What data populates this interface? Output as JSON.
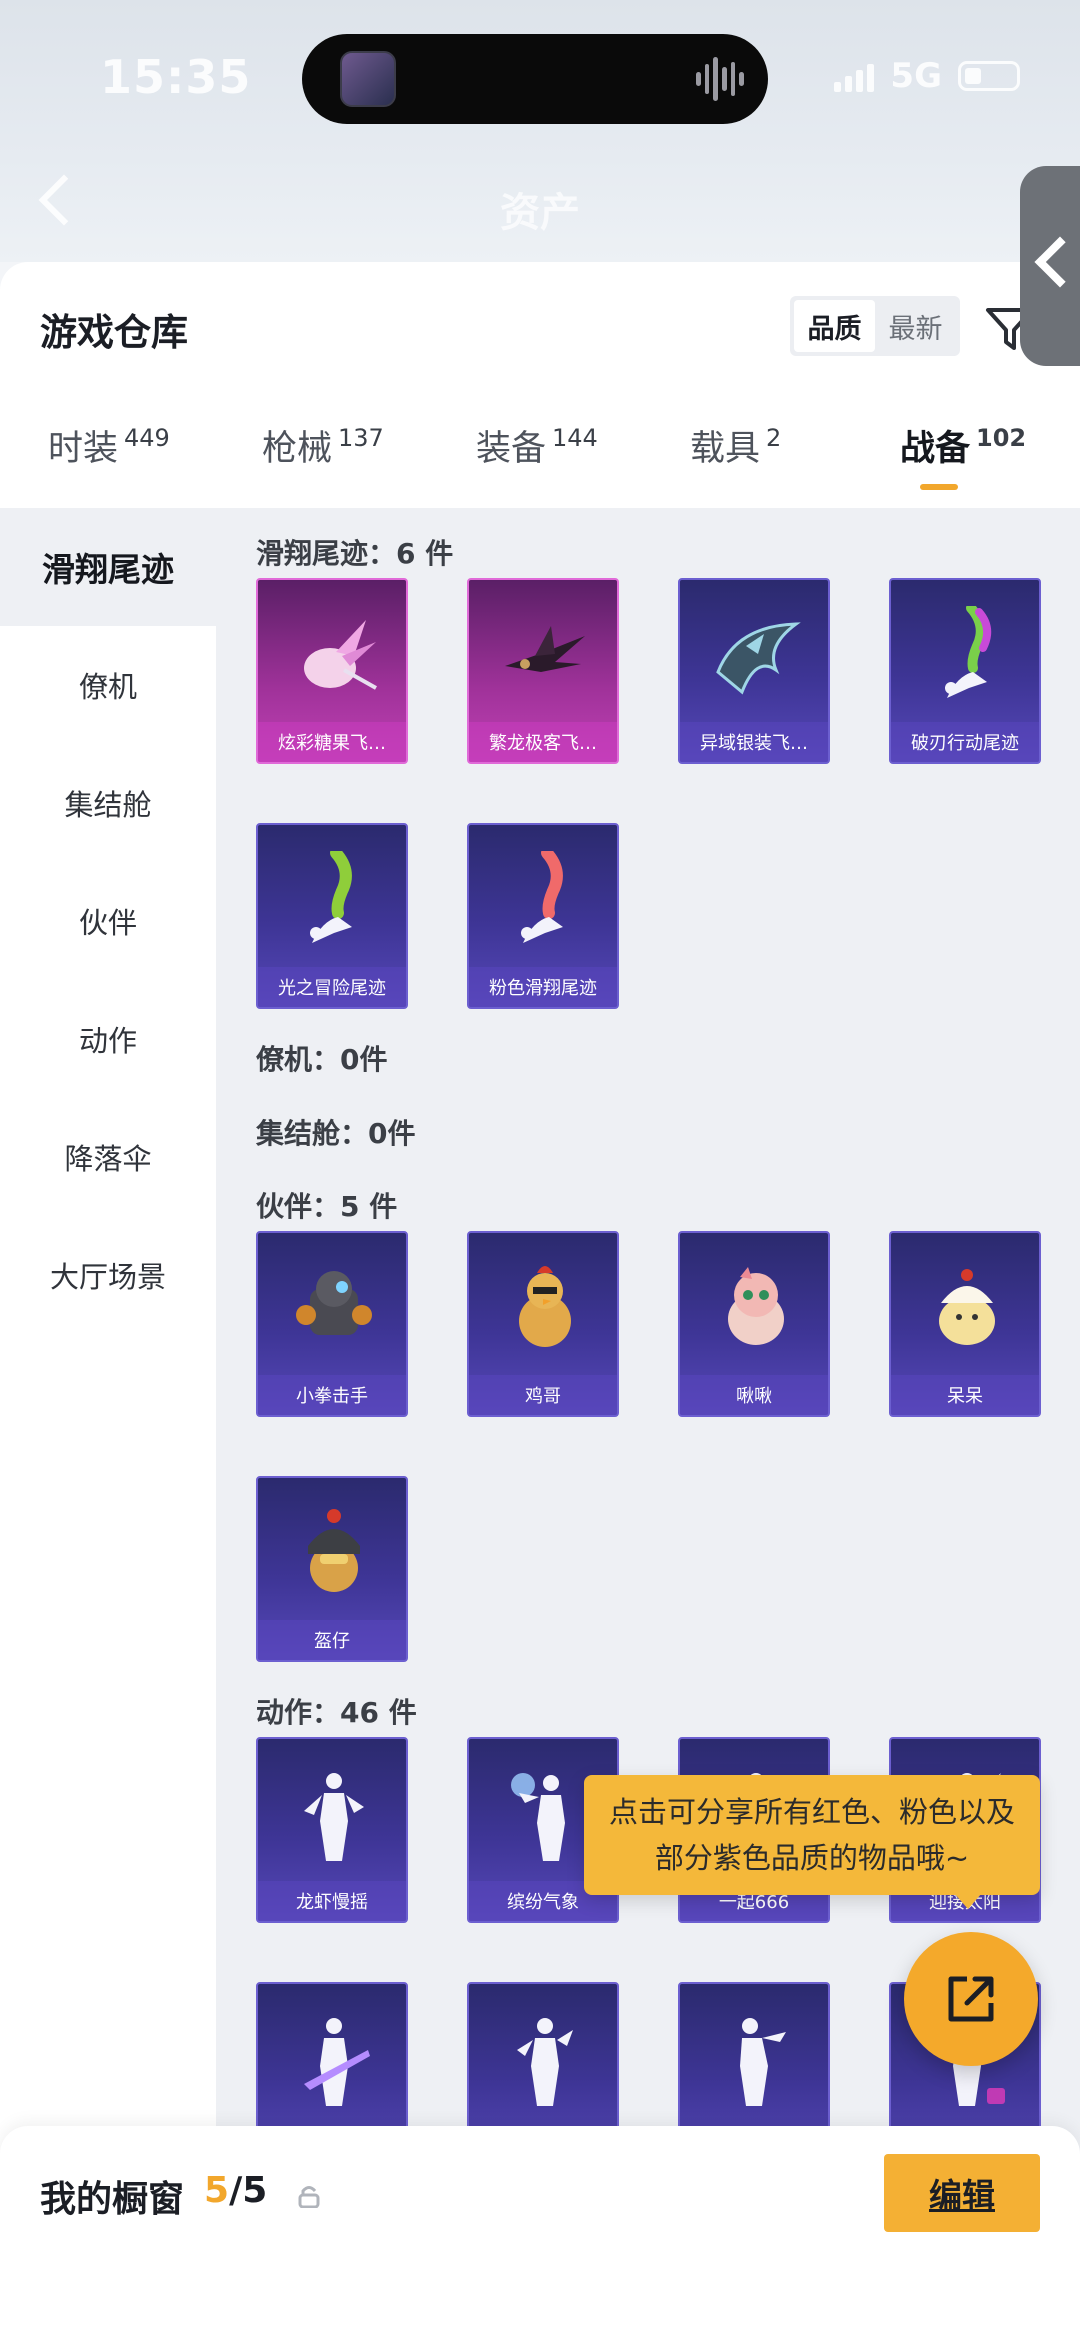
{
  "status": {
    "time": "15:35",
    "network": "5G"
  },
  "header": {
    "title": "资产"
  },
  "warehouse": {
    "title": "游戏仓库",
    "sort": {
      "quality": "品质",
      "newest": "最新",
      "selected": "品质"
    }
  },
  "tabs": [
    {
      "label": "时装",
      "count": "449"
    },
    {
      "label": "枪械",
      "count": "137"
    },
    {
      "label": "装备",
      "count": "144"
    },
    {
      "label": "载具",
      "count": "2"
    },
    {
      "label": "战备",
      "count": "102",
      "active": true
    }
  ],
  "sidebar": {
    "items": [
      {
        "label": "滑翔尾迹",
        "active": true
      },
      {
        "label": "僚机"
      },
      {
        "label": "集结舱"
      },
      {
        "label": "伙伴"
      },
      {
        "label": "动作"
      },
      {
        "label": "降落伞"
      },
      {
        "label": "大厅场景"
      }
    ]
  },
  "sections": {
    "glide": {
      "label": "滑翔尾迹：6 件"
    },
    "wingman": {
      "label": "僚机：0件"
    },
    "pod": {
      "label": "集结舱：0件"
    },
    "partner": {
      "label": "伙伴：5 件"
    },
    "emote": {
      "label": "动作：46 件"
    }
  },
  "items": {
    "glide": [
      "炫彩糖果飞…",
      "繁龙极客飞…",
      "异域银装飞…",
      "破刃行动尾迹",
      "光之冒险尾迹",
      "粉色滑翔尾迹"
    ],
    "partner": [
      "小拳击手",
      "鸡哥",
      "啾啾",
      "呆呆",
      "盔仔"
    ],
    "emote": [
      "龙虾慢摇",
      "缤纷气象",
      "一起666",
      "迎接太阳",
      "",
      "",
      "",
      ""
    ]
  },
  "tooltip": {
    "line1": "点击可分享所有红色、粉色以及",
    "line2": "部分紫色品质的物品哦~"
  },
  "showcase": {
    "label": "我的橱窗",
    "current": "5",
    "total": "/5",
    "edit_label": "编辑"
  },
  "colors": {
    "accent": "#f2a72c",
    "card_purple": "#3e3596",
    "card_pink": "#a0329a"
  }
}
